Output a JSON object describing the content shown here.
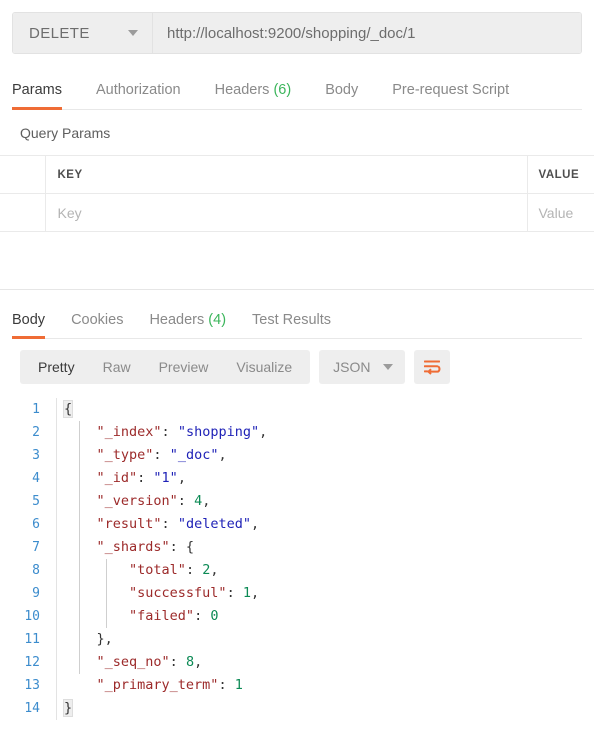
{
  "request": {
    "method": "DELETE",
    "method_dropdown_icon": "chevron-down-icon",
    "url": "http://localhost:9200/shopping/_doc/1",
    "url_placeholder": "Enter request URL",
    "tabs": [
      {
        "label": "Params",
        "count": "",
        "active": true
      },
      {
        "label": "Authorization",
        "count": "",
        "active": false
      },
      {
        "label": "Headers",
        "count": "(6)",
        "active": false
      },
      {
        "label": "Body",
        "count": "",
        "active": false
      },
      {
        "label": "Pre-request Script",
        "count": "",
        "active": false
      }
    ]
  },
  "query_params": {
    "title": "Query Params",
    "columns": [
      "",
      "KEY",
      "VALUE"
    ],
    "rows": [
      {
        "checked": false,
        "key": "",
        "value": "",
        "key_placeholder": "Key",
        "value_placeholder": "Value"
      }
    ]
  },
  "response": {
    "tabs": [
      {
        "label": "Body",
        "count": "",
        "active": true
      },
      {
        "label": "Cookies",
        "count": "",
        "active": false
      },
      {
        "label": "Headers",
        "count": "(4)",
        "active": false
      },
      {
        "label": "Test Results",
        "count": "",
        "active": false
      }
    ],
    "view_modes": [
      {
        "label": "Pretty",
        "active": true
      },
      {
        "label": "Raw",
        "active": false
      },
      {
        "label": "Preview",
        "active": false
      },
      {
        "label": "Visualize",
        "active": false
      }
    ],
    "format": {
      "selected": "JSON",
      "dropdown_icon": "chevron-down-icon"
    },
    "wrap_button": {
      "icon": "word-wrap-icon"
    },
    "body_lines": [
      {
        "n": "1",
        "tokens": [
          {
            "t": "{",
            "c": "p"
          }
        ]
      },
      {
        "n": "2",
        "tokens": [
          {
            "t": "    ",
            "c": "p"
          },
          {
            "t": "\"_index\"",
            "c": "k"
          },
          {
            "t": ": ",
            "c": "p"
          },
          {
            "t": "\"shopping\"",
            "c": "s"
          },
          {
            "t": ",",
            "c": "p"
          }
        ]
      },
      {
        "n": "3",
        "tokens": [
          {
            "t": "    ",
            "c": "p"
          },
          {
            "t": "\"_type\"",
            "c": "k"
          },
          {
            "t": ": ",
            "c": "p"
          },
          {
            "t": "\"_doc\"",
            "c": "s"
          },
          {
            "t": ",",
            "c": "p"
          }
        ]
      },
      {
        "n": "4",
        "tokens": [
          {
            "t": "    ",
            "c": "p"
          },
          {
            "t": "\"_id\"",
            "c": "k"
          },
          {
            "t": ": ",
            "c": "p"
          },
          {
            "t": "\"1\"",
            "c": "s"
          },
          {
            "t": ",",
            "c": "p"
          }
        ]
      },
      {
        "n": "5",
        "tokens": [
          {
            "t": "    ",
            "c": "p"
          },
          {
            "t": "\"_version\"",
            "c": "k"
          },
          {
            "t": ": ",
            "c": "p"
          },
          {
            "t": "4",
            "c": "n"
          },
          {
            "t": ",",
            "c": "p"
          }
        ]
      },
      {
        "n": "6",
        "tokens": [
          {
            "t": "    ",
            "c": "p"
          },
          {
            "t": "\"result\"",
            "c": "k"
          },
          {
            "t": ": ",
            "c": "p"
          },
          {
            "t": "\"deleted\"",
            "c": "s"
          },
          {
            "t": ",",
            "c": "p"
          }
        ]
      },
      {
        "n": "7",
        "tokens": [
          {
            "t": "    ",
            "c": "p"
          },
          {
            "t": "\"_shards\"",
            "c": "k"
          },
          {
            "t": ": {",
            "c": "p"
          }
        ]
      },
      {
        "n": "8",
        "tokens": [
          {
            "t": "        ",
            "c": "p"
          },
          {
            "t": "\"total\"",
            "c": "k"
          },
          {
            "t": ": ",
            "c": "p"
          },
          {
            "t": "2",
            "c": "n"
          },
          {
            "t": ",",
            "c": "p"
          }
        ]
      },
      {
        "n": "9",
        "tokens": [
          {
            "t": "        ",
            "c": "p"
          },
          {
            "t": "\"successful\"",
            "c": "k"
          },
          {
            "t": ": ",
            "c": "p"
          },
          {
            "t": "1",
            "c": "n"
          },
          {
            "t": ",",
            "c": "p"
          }
        ]
      },
      {
        "n": "10",
        "tokens": [
          {
            "t": "        ",
            "c": "p"
          },
          {
            "t": "\"failed\"",
            "c": "k"
          },
          {
            "t": ": ",
            "c": "p"
          },
          {
            "t": "0",
            "c": "n"
          }
        ]
      },
      {
        "n": "11",
        "tokens": [
          {
            "t": "    },",
            "c": "p"
          }
        ]
      },
      {
        "n": "12",
        "tokens": [
          {
            "t": "    ",
            "c": "p"
          },
          {
            "t": "\"_seq_no\"",
            "c": "k"
          },
          {
            "t": ": ",
            "c": "p"
          },
          {
            "t": "8",
            "c": "n"
          },
          {
            "t": ",",
            "c": "p"
          }
        ]
      },
      {
        "n": "13",
        "tokens": [
          {
            "t": "    ",
            "c": "p"
          },
          {
            "t": "\"_primary_term\"",
            "c": "k"
          },
          {
            "t": ": ",
            "c": "p"
          },
          {
            "t": "1",
            "c": "n"
          }
        ]
      },
      {
        "n": "14",
        "tokens": [
          {
            "t": "}",
            "c": "p"
          }
        ]
      }
    ],
    "body_json": {
      "_index": "shopping",
      "_type": "_doc",
      "_id": "1",
      "_version": 4,
      "result": "deleted",
      "_shards": {
        "total": 2,
        "successful": 1,
        "failed": 0
      },
      "_seq_no": 8,
      "_primary_term": 1
    }
  },
  "colors": {
    "accent": "#ef6c35",
    "count_green": "#3bb55b",
    "line_number": "#3c8ccd",
    "json_key": "#9c2a2a",
    "json_string": "#1f22b7",
    "json_number": "#0c8a55"
  }
}
